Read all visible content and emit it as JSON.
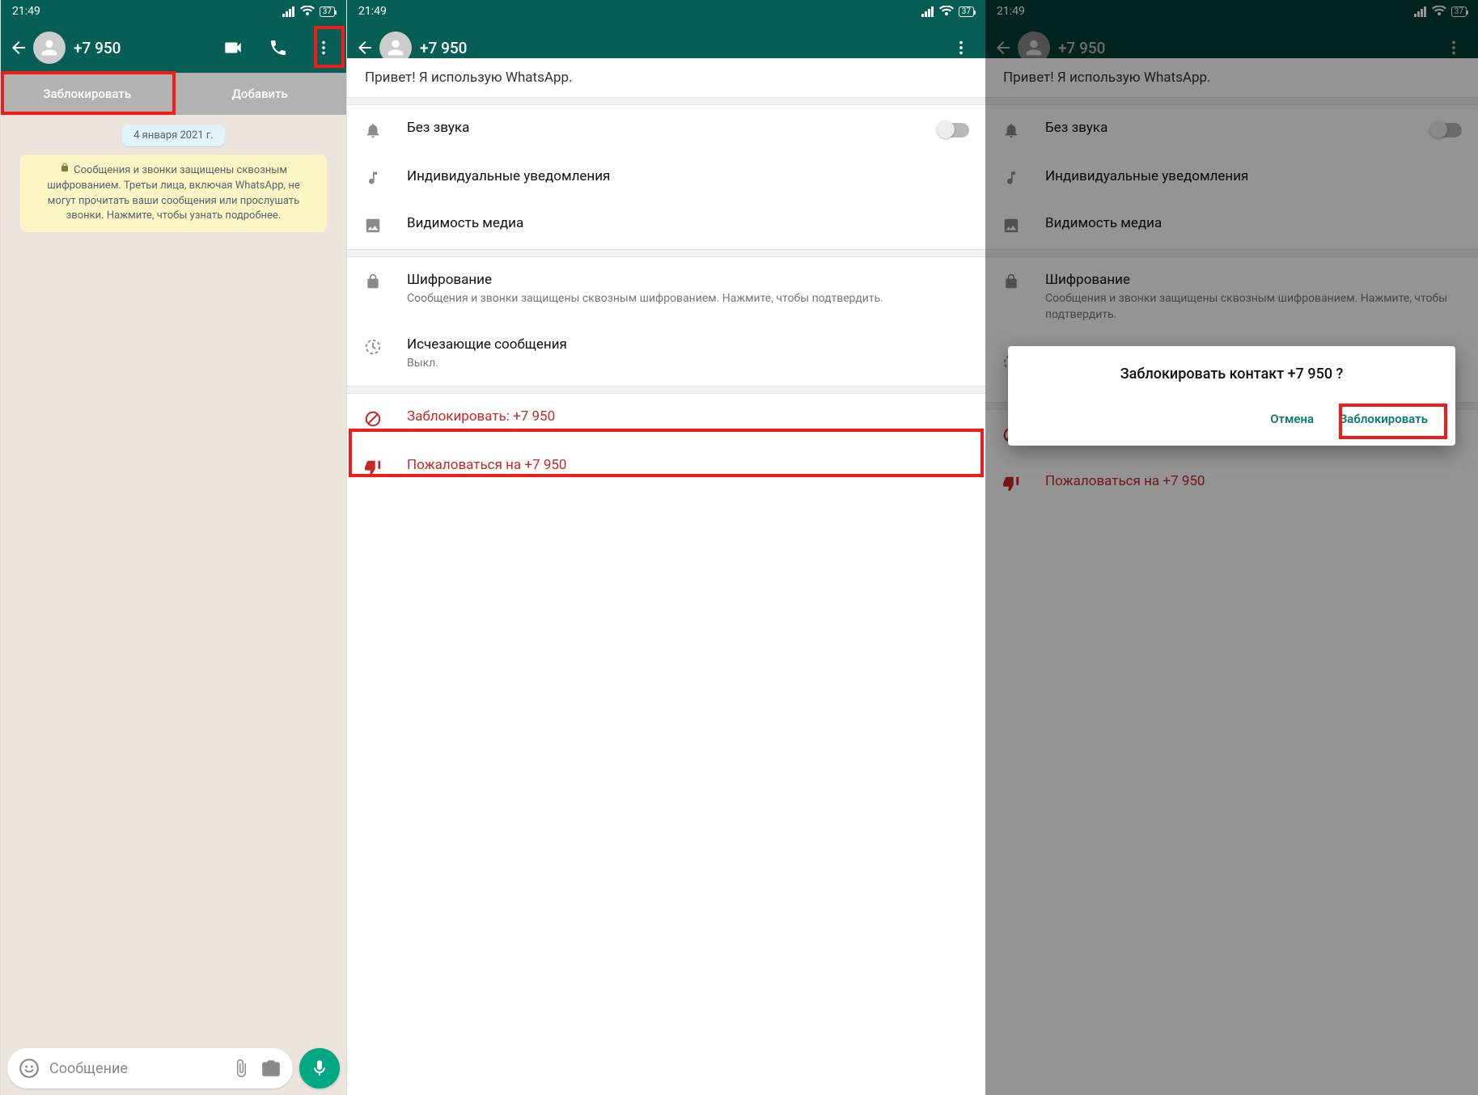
{
  "status": {
    "time": "21:49",
    "battery": "37"
  },
  "contact": {
    "name": "+7 950"
  },
  "screen1": {
    "block_label": "Заблокировать",
    "add_label": "Добавить",
    "date_chip": "4 января 2021 г.",
    "encryption_notice": "Сообщения и звонки защищены сквозным шифрованием. Третьи лица, включая WhatsApp, не могут прочитать ваши сообщения или прослушать звонки. Нажмите, чтобы узнать подробнее.",
    "composer_placeholder": "Сообщение"
  },
  "screen2": {
    "status_line": "Привет! Я использую WhatsApp.",
    "settings": {
      "mute": "Без звука",
      "custom_notifications": "Индивидуальные уведомления",
      "media_visibility": "Видимость медиа",
      "encryption_title": "Шифрование",
      "encryption_sub": "Сообщения и звонки защищены сквозным шифрованием. Нажмите, чтобы подтвердить.",
      "disappearing_title": "Исчезающие сообщения",
      "disappearing_sub": "Выкл.",
      "block": "Заблокировать: +7 950",
      "report": "Пожаловаться на +7 950"
    }
  },
  "dialog": {
    "title": "Заблокировать контакт +7 950 ?",
    "cancel": "Отмена",
    "confirm": "Заблокировать"
  }
}
